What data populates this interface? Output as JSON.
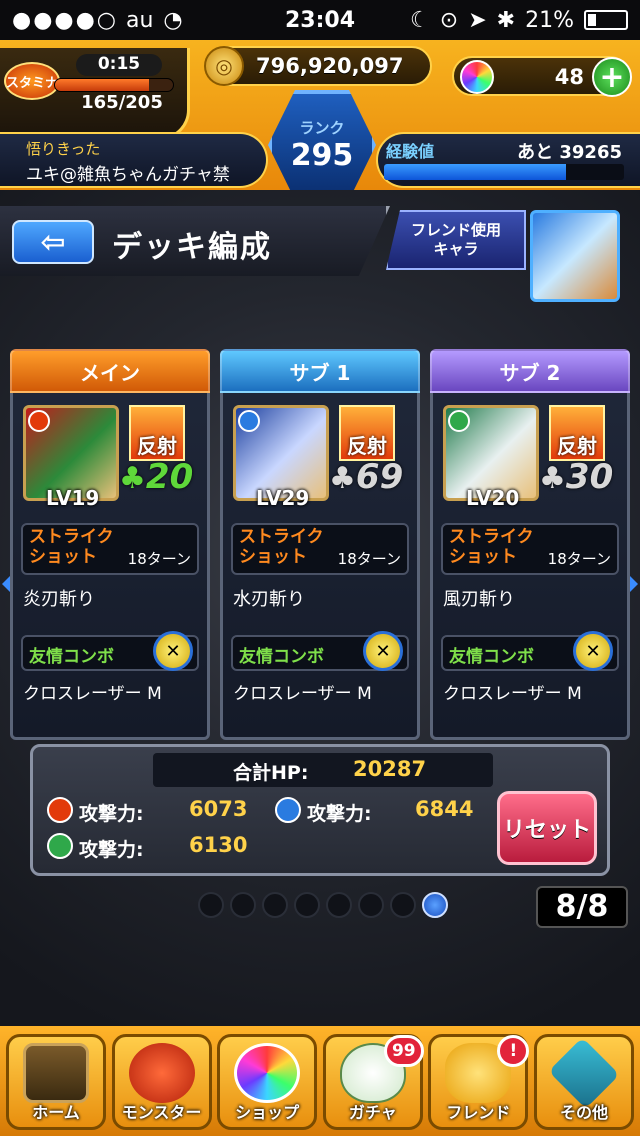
{
  "status": {
    "carrier": "au",
    "time": "23:04",
    "battery": "21%"
  },
  "header": {
    "stamina_label": "スタミナ",
    "stamina_timer": "0:15",
    "stamina_value": "165/205",
    "stamina_fraction": 0.8,
    "gold": "796,920,097",
    "orbs": "48",
    "rank_label": "ランク",
    "rank": "295",
    "user_title": "悟りきった",
    "user_name": "ユキ@雑魚ちゃんガチャ禁",
    "exp_label": "経験値",
    "exp_remaining": "あと 39265",
    "exp_fraction": 0.76
  },
  "deck": {
    "title": "デッキ編成",
    "back_glyph": "⇦",
    "friend_button": [
      "フレンド使用",
      "キャラ"
    ]
  },
  "cards": [
    {
      "tab": "メイン",
      "level": "LV19",
      "reflect": "反射",
      "luck": "20",
      "ss_label": "ストライクショット",
      "ss_turns": "18ターン",
      "ss_name": "炎刃斬り",
      "combo_label": "友情コンボ",
      "combo_name": "クロスレーザー M"
    },
    {
      "tab": "サブ 1",
      "level": "LV29",
      "reflect": "反射",
      "luck": "69",
      "ss_label": "ストライクショット",
      "ss_turns": "18ターン",
      "ss_name": "水刃斬り",
      "combo_label": "友情コンボ",
      "combo_name": "クロスレーザー M"
    },
    {
      "tab": "サブ 2",
      "level": "LV20",
      "reflect": "反射",
      "luck": "30",
      "ss_label": "ストライクショット",
      "ss_turns": "18ターン",
      "ss_name": "風刃斬り",
      "combo_label": "友情コンボ",
      "combo_name": "クロスレーザー M"
    }
  ],
  "summary": {
    "hp_label": "合計HP:",
    "hp": "20287",
    "atk_label": "攻撃力:",
    "fire_atk": "6073",
    "water_atk": "6844",
    "wood_atk": "6130",
    "reset": "リセット"
  },
  "pager": {
    "count": "8/8",
    "total": 8,
    "active": 8
  },
  "tabbar": [
    {
      "label": "ホーム",
      "icon": "home-gate-icon"
    },
    {
      "label": "モンスター",
      "icon": "monster-icon"
    },
    {
      "label": "ショップ",
      "icon": "rainbow-orb-icon"
    },
    {
      "label": "ガチャ",
      "icon": "egg-icon",
      "badge": "99"
    },
    {
      "label": "フレンド",
      "icon": "friends-icon",
      "badge": "!"
    },
    {
      "label": "その他",
      "icon": "other-icon"
    }
  ],
  "colors": {
    "fire": "#e23a0a",
    "water": "#2a7be0",
    "wood": "#2fa84a",
    "accent": "#ffd24a"
  }
}
